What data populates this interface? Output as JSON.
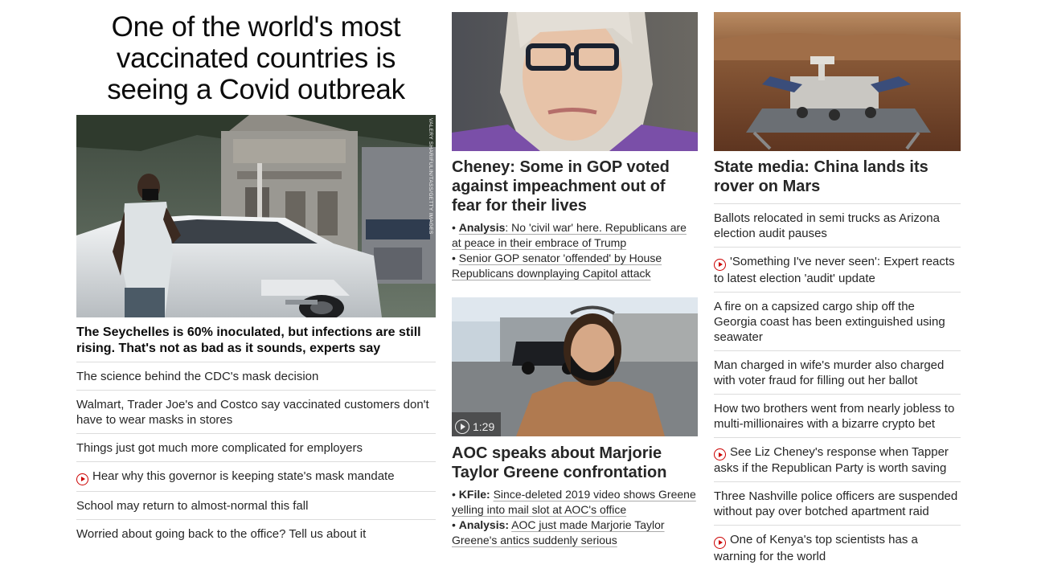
{
  "col1": {
    "headline": "One of the world's most vaccinated countries is seeing a Covid outbreak",
    "hero_credit": "VALERY SHARIFULIN/TASS/GETTY IMAGES",
    "lead": "The Seychelles is 60% inoculated, but infections are still rising. That's not as bad as it sounds, experts say",
    "items": [
      {
        "text": "The science behind the CDC's mask decision",
        "video": false
      },
      {
        "text": "Walmart, Trader Joe's and Costco say vaccinated customers don't have to wear masks in stores",
        "video": false
      },
      {
        "text": "Things just got much more complicated for employers",
        "video": false
      },
      {
        "text": "Hear why this governor is keeping state's mask mandate",
        "video": true
      },
      {
        "text": "School may return to almost-normal this fall",
        "video": false
      },
      {
        "text": "Worried about going back to the office? Tell us about it",
        "video": false
      }
    ]
  },
  "col2": {
    "story1": {
      "headline": "Cheney: Some in GOP voted against impeachment out of fear for their lives",
      "sub1_prefix": "Analysis",
      "sub1_text": ": No 'civil war' here. Republicans are at peace in their embrace of Trump",
      "sub2_text": "Senior GOP senator 'offended' by House Republicans downplaying Capitol attack"
    },
    "story2": {
      "duration": "1:29",
      "headline": "AOC speaks about Marjorie Taylor Greene confrontation",
      "sub1_prefix": "KFile:",
      "sub1_text": "Since-deleted 2019 video shows Greene yelling into mail slot at AOC's office",
      "sub2_prefix": "Analysis:",
      "sub2_text": "AOC just made Marjorie Taylor Greene's antics suddenly serious"
    }
  },
  "col3": {
    "headline": "State media: China lands its rover on Mars",
    "items": [
      {
        "text": "Ballots relocated in semi trucks as Arizona election audit pauses",
        "video": false
      },
      {
        "text": "'Something I've never seen': Expert reacts to latest election 'audit' update",
        "video": true
      },
      {
        "text": "A fire on a capsized cargo ship off the Georgia coast has been extinguished using seawater",
        "video": false
      },
      {
        "text": "Man charged in wife's murder also charged with voter fraud for filling out her ballot",
        "video": false
      },
      {
        "text": "How two brothers went from nearly jobless to multi-millionaires with a bizarre crypto bet",
        "video": false
      },
      {
        "text": "See Liz Cheney's response when Tapper asks if the Republican Party is worth saving",
        "video": true
      },
      {
        "text": "Three Nashville police officers are suspended without pay over botched apartment raid",
        "video": false
      },
      {
        "text": "One of Kenya's top scientists has a warning for the world",
        "video": true
      }
    ]
  },
  "colors": {
    "video_red": "#cc0000",
    "divider": "#dcdcdc",
    "text": "#262626"
  }
}
